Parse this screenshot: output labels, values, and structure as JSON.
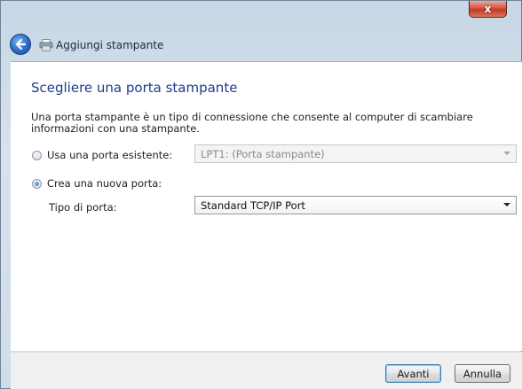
{
  "window": {
    "title": "Aggiungi stampante",
    "close_glyph": "x"
  },
  "page": {
    "heading": "Scegliere una porta stampante",
    "description": "Una porta stampante è un tipo di connessione che consente al computer di scambiare informazioni con una stampante."
  },
  "options": {
    "existing_port_label": "Usa una porta esistente:",
    "existing_port_value": "LPT1: (Porta stampante)",
    "existing_port_selected": false,
    "new_port_label": "Crea una nuova porta:",
    "new_port_selected": true,
    "port_type_label": "Tipo di porta:",
    "port_type_value": "Standard TCP/IP Port"
  },
  "buttons": {
    "next": "Avanti",
    "cancel": "Annulla"
  },
  "icons": {
    "back": "back-arrow-icon",
    "printer": "printer-icon",
    "close": "close-icon"
  },
  "colors": {
    "heading": "#1f3d8c",
    "close_button": "#c23a23",
    "back_button": "#2a6cc4"
  }
}
